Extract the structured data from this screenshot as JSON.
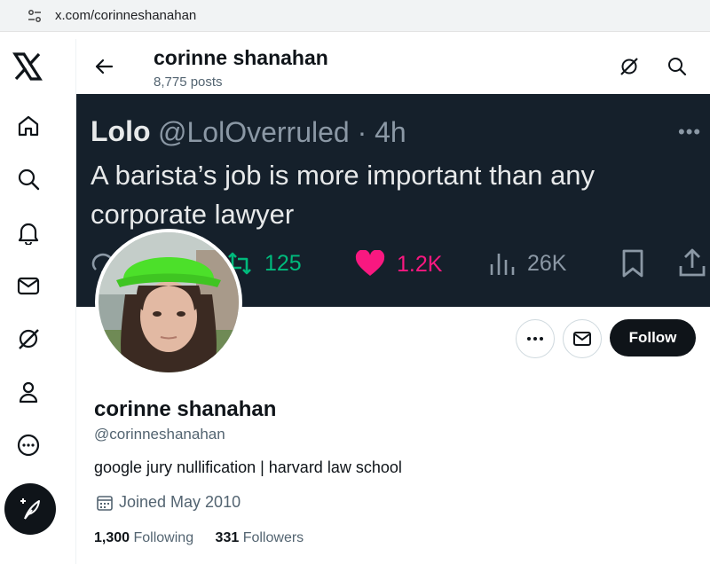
{
  "browser": {
    "url": "x.com/corinneshanahan"
  },
  "nav": {
    "items": [
      "home",
      "explore",
      "notifications",
      "messages",
      "grok",
      "profile",
      "more"
    ]
  },
  "header": {
    "name": "corinne shanahan",
    "posts": "8,775 posts"
  },
  "banner": {
    "name": "Lolo",
    "handle_time": "@LolOverruled · 4h",
    "more": "•••",
    "text": "A barista’s job is more important than any corporate lawyer",
    "retweets": "125",
    "likes": "1.2K",
    "views": "26K",
    "colors": {
      "bg": "#15202b",
      "retweet": "#00ba7c",
      "like": "#f91880",
      "muted": "#8b98a5"
    }
  },
  "actions": {
    "follow_label": "Follow"
  },
  "profile": {
    "name": "corinne shanahan",
    "handle": "@corinneshanahan",
    "bio": "google jury nullification | harvard law school",
    "joined": "Joined May 2010",
    "following_count": "1,300",
    "following_label": "Following",
    "followers_count": "331",
    "followers_label": "Followers"
  }
}
